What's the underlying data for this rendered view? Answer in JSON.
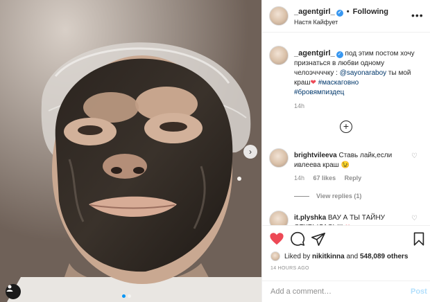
{
  "post": {
    "photo_alt_icon": "photo-of-person-with-face-mask",
    "carousel_dots": 2,
    "active_dot": 0
  },
  "header": {
    "username": "_agentgirl_",
    "separator": "•",
    "follow_label": "Following",
    "location": "Настя Кайфует",
    "more_icon": "more-horizontal-icon"
  },
  "caption": {
    "username": "_agentgirl_",
    "text_part1": "под этим постом хочу признаться в любви одному челоэччччку : ",
    "mention": "@sayonaraboy",
    "text_part2": " ты мой краш",
    "heart": "❤",
    "hashtag1": "#маскаговно",
    "hashtag2": "#бровямпиздец",
    "time": "14h"
  },
  "comments": [
    {
      "username": "brightvileeva",
      "text": "Ставь лайк,если ивлеева краш ",
      "emoji": "😉",
      "time": "14h",
      "likes": "67 likes",
      "reply": "Reply",
      "view_replies": "View replies (1)"
    },
    {
      "username": "it.plyshka",
      "text": "ВАУ А ТЫ ТАЙНУ ОТКРЫЛАСЬ!!! ",
      "emoji": "❤"
    }
  ],
  "actions": {
    "liked_prefix": "Liked by ",
    "liked_user": "nikitkinna",
    "liked_and": " and ",
    "liked_count": "548,089 others",
    "time_ago": "14 HOURS AGO"
  },
  "add_comment": {
    "placeholder": "Add a comment…",
    "post_label": "Post"
  },
  "colors": {
    "link": "#00376b",
    "verified": "#3897f0",
    "heart": "#ed4956",
    "post_disabled": "#b2dffc"
  }
}
